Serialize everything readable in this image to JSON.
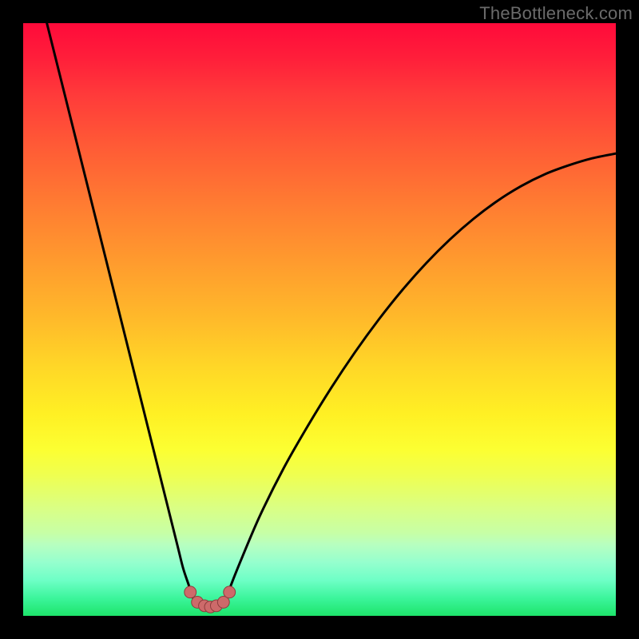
{
  "watermark": {
    "text": "TheBottleneck.com"
  },
  "colors": {
    "frame": "#000000",
    "curve": "#000000",
    "marker_fill": "#cd6a6a",
    "marker_stroke": "#8e3d3d",
    "gradient_stops": [
      "#ff0a3a",
      "#ff1f3a",
      "#ff3a3a",
      "#ff5836",
      "#ff7a32",
      "#ff9a2e",
      "#ffba2a",
      "#ffd727",
      "#fff024",
      "#fcff32",
      "#f0ff4e",
      "#d9ff86",
      "#c7ffa6",
      "#b7ffc0",
      "#95ffce",
      "#6effc6",
      "#3cf59c",
      "#1de46a"
    ]
  },
  "chart_data": {
    "type": "line",
    "title": "",
    "xlabel": "",
    "ylabel": "",
    "xlim": [
      0,
      100
    ],
    "ylim": [
      0,
      100
    ],
    "grid": false,
    "legend": false,
    "note": "Axes are unlabeled in the source image; values below are in percent of the plot box, with y measured from the bottom. The curve is a V-shaped bottleneck profile with a flat bottom near x≈29–34.",
    "series": [
      {
        "name": "left-branch",
        "x": [
          4.0,
          6.0,
          8.0,
          10.0,
          12.0,
          14.0,
          16.0,
          18.0,
          20.0,
          22.0,
          24.0,
          26.0,
          27.0,
          28.0
        ],
        "y": [
          100.0,
          92.0,
          84.0,
          76.0,
          68.0,
          60.0,
          52.0,
          44.0,
          36.0,
          28.0,
          20.0,
          12.0,
          8.0,
          5.0
        ]
      },
      {
        "name": "valley-bottom",
        "x": [
          28.2,
          29.0,
          30.0,
          31.0,
          32.0,
          33.0,
          34.0,
          34.8
        ],
        "y": [
          4.0,
          2.5,
          1.8,
          1.5,
          1.5,
          1.7,
          2.4,
          4.0
        ]
      },
      {
        "name": "right-branch",
        "x": [
          35.0,
          37.0,
          40.0,
          44.0,
          48.0,
          52.0,
          56.0,
          60.0,
          64.0,
          68.0,
          72.0,
          76.0,
          80.0,
          84.0,
          88.0,
          92.0,
          96.0,
          100.0
        ],
        "y": [
          5.0,
          10.0,
          17.0,
          25.0,
          32.0,
          38.5,
          44.5,
          50.0,
          55.0,
          59.5,
          63.5,
          67.0,
          70.0,
          72.5,
          74.5,
          76.0,
          77.2,
          78.0
        ]
      }
    ],
    "markers": {
      "name": "valley-markers",
      "points_x": [
        28.2,
        29.4,
        30.6,
        31.6,
        32.6,
        33.8,
        34.8
      ],
      "points_y": [
        4.0,
        2.3,
        1.7,
        1.5,
        1.7,
        2.3,
        4.0
      ],
      "radius_pct": 1.0
    }
  }
}
